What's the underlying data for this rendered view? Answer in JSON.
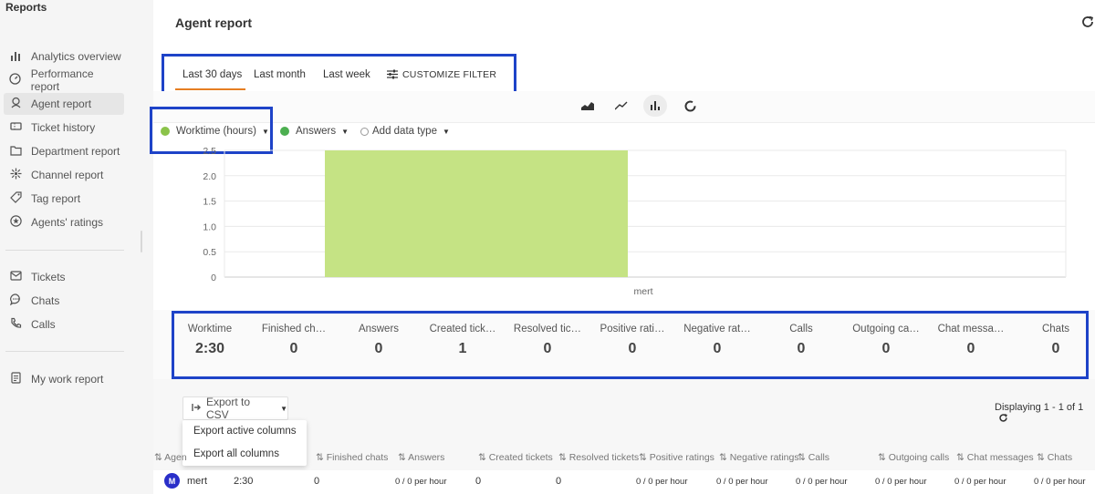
{
  "sidebar": {
    "title": "Reports",
    "items": [
      {
        "label": "Analytics overview",
        "icon": "bar-chart-icon"
      },
      {
        "label": "Performance report",
        "icon": "gauge-icon"
      },
      {
        "label": "Agent report",
        "icon": "agent-icon"
      },
      {
        "label": "Ticket history",
        "icon": "ticket-icon"
      },
      {
        "label": "Department report",
        "icon": "folder-icon"
      },
      {
        "label": "Channel report",
        "icon": "channel-icon"
      },
      {
        "label": "Tag report",
        "icon": "tag-icon"
      },
      {
        "label": "Agents' ratings",
        "icon": "star-icon"
      },
      {
        "label": "Tickets",
        "icon": "mail-icon"
      },
      {
        "label": "Chats",
        "icon": "chat-icon"
      },
      {
        "label": "Calls",
        "icon": "phone-icon"
      },
      {
        "label": "My work report",
        "icon": "report-icon"
      }
    ]
  },
  "page": {
    "title": "Agent report",
    "refresh_icon": "refresh-icon"
  },
  "tabs": {
    "items": [
      "Last 30 days",
      "Last month",
      "Last week"
    ],
    "customize": "CUSTOMIZE FILTER",
    "active": "Last 30 days"
  },
  "chart_toolbar": [
    "area-chart-icon",
    "line-chart-icon",
    "bar-chart-icon",
    "donut-chart-icon"
  ],
  "legend": [
    {
      "label": "Worktime (hours)",
      "color": "#8bc34a"
    },
    {
      "label": "Answers",
      "color": "#4caf50"
    },
    {
      "label": "Add data type",
      "color": "#ffffff"
    }
  ],
  "chart_data": {
    "type": "bar",
    "categories": [
      "mert"
    ],
    "series": [
      {
        "name": "Worktime (hours)",
        "values": [
          2.5
        ]
      }
    ],
    "yticks": [
      "2.5",
      "2.0",
      "1.5",
      "1.0",
      "0.5",
      "0"
    ],
    "ylim": [
      0,
      2.5
    ],
    "bar_color": "#c5e384",
    "grid": true
  },
  "stats": [
    {
      "label": "Worktime",
      "value": "2:30"
    },
    {
      "label": "Finished ch…",
      "value": "0"
    },
    {
      "label": "Answers",
      "value": "0"
    },
    {
      "label": "Created tick…",
      "value": "1"
    },
    {
      "label": "Resolved tic…",
      "value": "0"
    },
    {
      "label": "Positive rati…",
      "value": "0"
    },
    {
      "label": "Negative rat…",
      "value": "0"
    },
    {
      "label": "Calls",
      "value": "0"
    },
    {
      "label": "Outgoing ca…",
      "value": "0"
    },
    {
      "label": "Chat messa…",
      "value": "0"
    },
    {
      "label": "Chats",
      "value": "0"
    }
  ],
  "export": {
    "button": "Export to CSV",
    "menu": [
      "Export active columns",
      "Export all columns"
    ]
  },
  "pagination": "Displaying 1 - 1 of 1",
  "table": {
    "headers": [
      "Agen",
      "Finished chats",
      "Answers",
      "Created tickets",
      "Resolved tickets",
      "Positive ratings",
      "Negative ratings",
      "Calls",
      "Outgoing calls",
      "Chat messages",
      "Chats"
    ],
    "row": {
      "avatar": "M",
      "agent": "mert",
      "worktime": "2:30",
      "finished_chats": "0",
      "answers": "0 / 0 per hour",
      "created_tickets": "0",
      "resolved_tickets": "0",
      "positive_ratings": "0 / 0 per hour",
      "negative_ratings": "0 / 0 per hour",
      "calls": "0 / 0 per hour",
      "outgoing_calls": "0 / 0 per hour",
      "chat_messages": "0 / 0 per hour",
      "chats": "0 / 0 per hour"
    }
  }
}
